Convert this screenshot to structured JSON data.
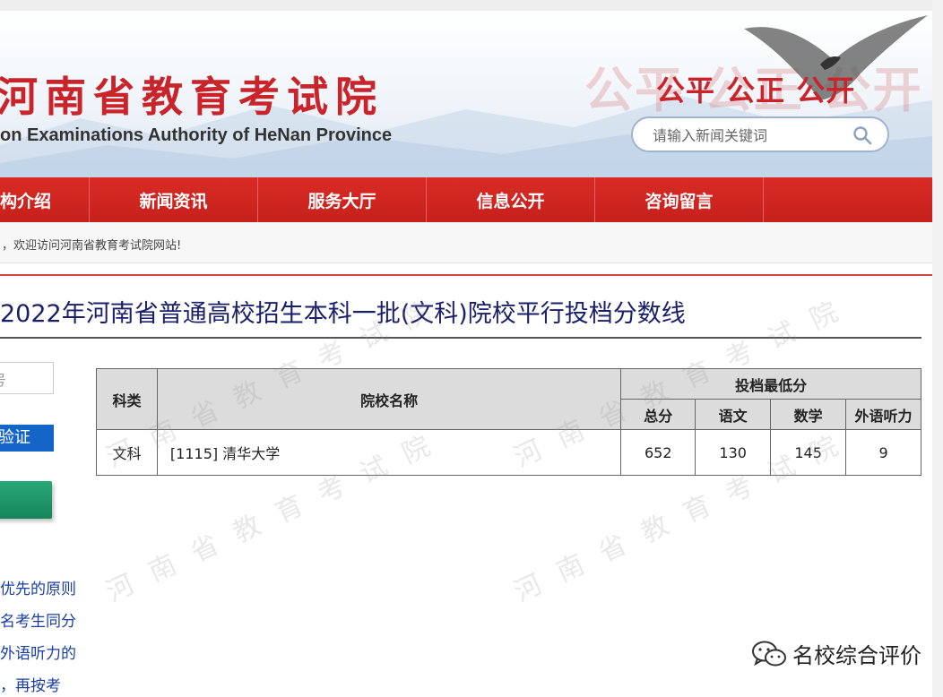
{
  "header": {
    "title_cn": "河南省教育考试院",
    "title_en": "on Examinations Authority of HeNan Province",
    "slogan": "公平 公正 公开",
    "slogan_ghost": "公平 公正 公开",
    "search": {
      "placeholder": "请输入新闻关键词"
    }
  },
  "nav": {
    "items": [
      {
        "label": "构介绍"
      },
      {
        "label": "新闻资讯"
      },
      {
        "label": "服务大厅"
      },
      {
        "label": "信息公开"
      },
      {
        "label": "咨询留言"
      }
    ]
  },
  "welcome": "，欢迎访问河南省教育考试院网站!",
  "main": {
    "title": "2022年河南省普通高校招生本科一批(文科)院校平行投档分数线",
    "watermark": "河南省教育考试院"
  },
  "sidebar": {
    "input_text": "号",
    "verify_label": "验证",
    "notes": [
      "优先的原则",
      "名考生同分",
      "外语听力的",
      "，再按考"
    ]
  },
  "table": {
    "headers": {
      "category": "科类",
      "school": "院校名称",
      "min_score_group": "投档最低分",
      "total": "总分",
      "chinese": "语文",
      "math": "数学",
      "listening": "外语听力"
    },
    "rows": [
      {
        "category": "文科",
        "school": "[1115] 清华大学",
        "total": "652",
        "chinese": "130",
        "math": "145",
        "listening": "9"
      }
    ]
  },
  "credit": {
    "text": "名校综合评价"
  },
  "colors": {
    "brand_red": "#c8242a",
    "nav_red": "#d92b25",
    "title_blue": "#1a1f6b",
    "verify_blue": "#1565c9",
    "green": "#1f9a6a"
  }
}
